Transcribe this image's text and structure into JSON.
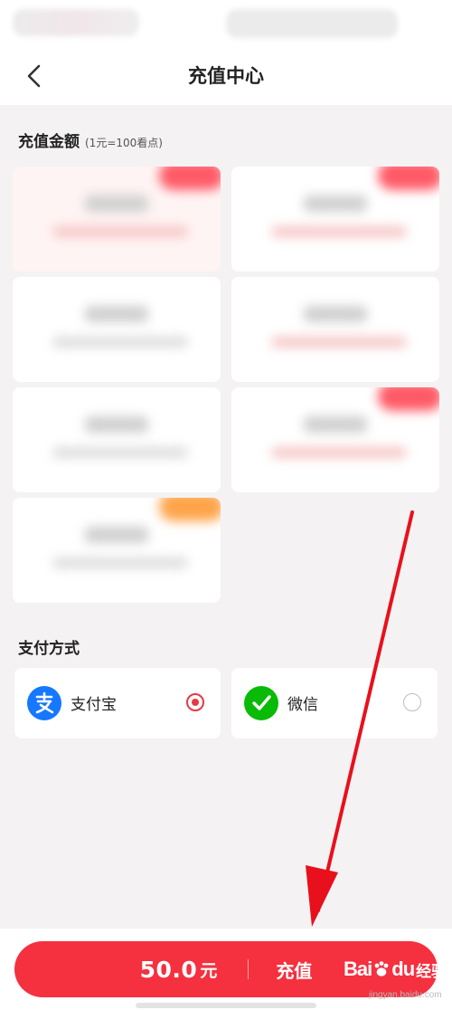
{
  "header": {
    "title": "充值中心",
    "back_icon": "chevron-left-icon"
  },
  "recharge": {
    "title": "充值金额",
    "rate_note": "(1元=100看点)"
  },
  "packages": [
    {
      "state": "selected",
      "badge": "red"
    },
    {
      "state": "normal",
      "badge": "red"
    },
    {
      "state": "normal",
      "badge": "none"
    },
    {
      "state": "normal",
      "badge": "none"
    },
    {
      "state": "normal",
      "badge": "none"
    },
    {
      "state": "normal",
      "badge": "red"
    },
    {
      "state": "normal",
      "badge": "orange"
    }
  ],
  "payment": {
    "title": "支付方式",
    "methods": [
      {
        "label": "支付宝",
        "icon": "alipay-icon",
        "selected": true,
        "color": "#1677ff"
      },
      {
        "label": "微信",
        "icon": "wechat-icon",
        "selected": false,
        "color": "#09bb07"
      }
    ]
  },
  "footer": {
    "amount": "50.0",
    "unit": "元",
    "action": "充值"
  },
  "watermark": {
    "brand": "Bai",
    "brand_suffix": "du",
    "product": "经验",
    "url": "jingyan.baidu.com"
  },
  "colors": {
    "accent": "#f5303f",
    "radio_checked": "#e83843",
    "arrow": "#e8101c"
  }
}
